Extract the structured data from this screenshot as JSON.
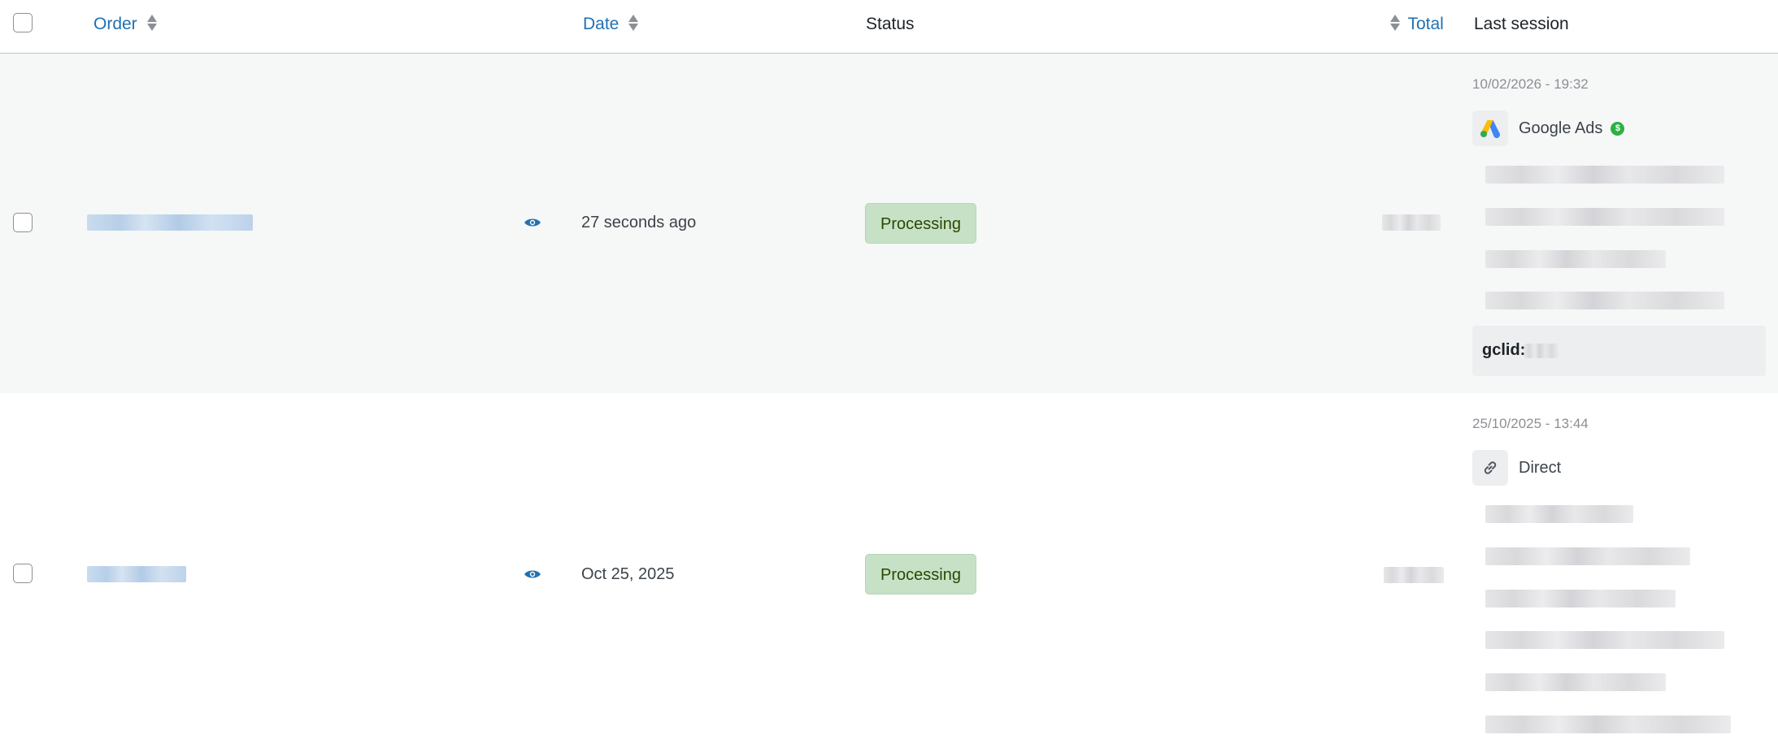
{
  "header": {
    "order_label": "Order",
    "date_label": "Date",
    "status_label": "Status",
    "total_label": "Total",
    "last_session_label": "Last session"
  },
  "rows": [
    {
      "date": "27 seconds ago",
      "status": "Processing",
      "session": {
        "time": "10/02/2026 - 19:32",
        "source": "Google Ads",
        "source_icon": "google-ads-icon",
        "paid_badge": "$",
        "gclid_label": "gclid:"
      }
    },
    {
      "date": "Oct 25, 2025",
      "status": "Processing",
      "session": {
        "time": "25/10/2025 - 13:44",
        "source": "Direct",
        "source_icon": "link-icon"
      }
    }
  ],
  "colors": {
    "link": "#2271b1",
    "status_processing_bg": "#c6e1c6",
    "status_processing_text": "#2c4700",
    "paid_badge": "#2db046",
    "row_alt_bg": "#f6f7f7"
  }
}
